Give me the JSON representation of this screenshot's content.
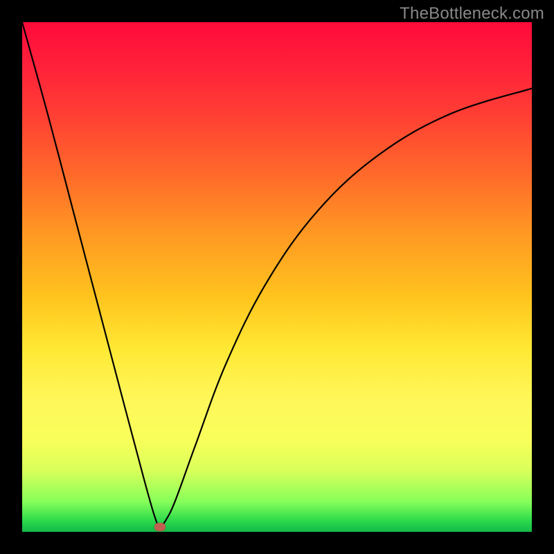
{
  "attribution": "TheBottleneck.com",
  "colors": {
    "top": "#ff0a3a",
    "bottom": "#14b848",
    "curve": "#000000",
    "marker": "#c06050",
    "frame": "#000000"
  },
  "chart_data": {
    "type": "line",
    "title": "",
    "xlabel": "",
    "ylabel": "",
    "xlim": [
      0,
      100
    ],
    "ylim": [
      0,
      100
    ],
    "grid": false,
    "legend": false,
    "note": "Values estimated from pixel positions; no axes/ticks shown. y=0 at bottom edge, y=100 at top edge.",
    "series": [
      {
        "name": "curve",
        "x": [
          0,
          5,
          10,
          15,
          20,
          24,
          26,
          27,
          28,
          30,
          34,
          40,
          48,
          58,
          70,
          84,
          100
        ],
        "y": [
          100,
          82,
          63,
          44,
          25,
          10,
          3,
          1,
          2,
          6,
          17,
          33,
          49,
          63,
          74,
          82,
          87
        ]
      }
    ],
    "marker": {
      "x": 27,
      "y": 1
    }
  }
}
